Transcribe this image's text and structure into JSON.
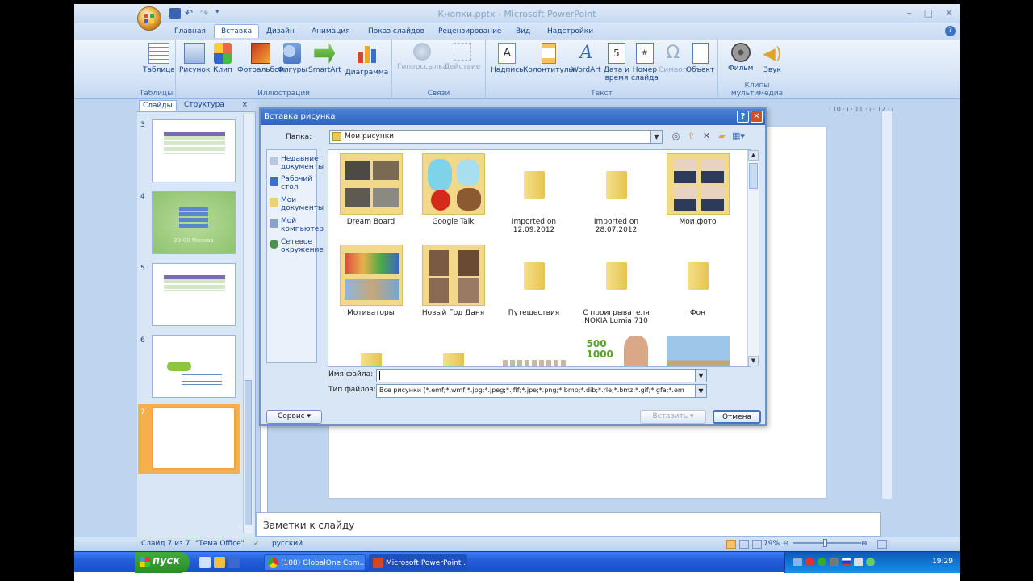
{
  "window": {
    "title": "Кнопки.pptx - Microsoft PowerPoint",
    "controls": [
      "–",
      "□",
      "✕"
    ]
  },
  "ribbon": {
    "tabs": [
      "Главная",
      "Вставка",
      "Дизайн",
      "Анимация",
      "Показ слайдов",
      "Рецензирование",
      "Вид",
      "Надстройки"
    ],
    "active_tab": "Вставка",
    "groups": {
      "tables": "Таблицы",
      "illustrations": "Иллюстрации",
      "links": "Связи",
      "text": "Текст",
      "media": "Клипы мультимедиа"
    },
    "buttons": {
      "table": "Таблица",
      "picture": "Рисунок",
      "clip": "Клип",
      "album": "Фотоальбом",
      "shapes": "Фигуры",
      "smartart": "SmartArt",
      "chart": "Диаграмма",
      "hyperlink": "Гиперссылка",
      "action": "Действие",
      "textbox": "Надпись",
      "header": "Колонтитулы",
      "wordart": "WordArt",
      "datetime_1": "Дата и",
      "datetime_2": "время",
      "slidenum_1": "Номер",
      "slidenum_2": "слайда",
      "symbol": "Символ",
      "object": "Объект",
      "movie": "Фильм",
      "sound": "Звук"
    }
  },
  "slides_panel": {
    "tabs": [
      "Слайды",
      "Структура"
    ],
    "slides": [
      {
        "num": "3"
      },
      {
        "num": "4",
        "caption": "20-00 Москва"
      },
      {
        "num": "5"
      },
      {
        "num": "6"
      },
      {
        "num": "7"
      }
    ]
  },
  "ruler_top": "· 10 · ı · 11 · ı · 12 · ı",
  "notes_placeholder": "Заметки к слайду",
  "status": {
    "slide": "Слайд 7 из 7",
    "theme": "\"Тема Office\"",
    "language": "русский",
    "zoom": "79%"
  },
  "dialog": {
    "title": "Вставка рисунка",
    "folder_label": "Папка:",
    "folder_value": "Мои рисунки",
    "places": [
      {
        "label": "Недавние документы"
      },
      {
        "label": "Рабочий стол"
      },
      {
        "label": "Мои документы"
      },
      {
        "label": "Мой компьютер"
      },
      {
        "label": "Сетевое окружение"
      }
    ],
    "files": [
      {
        "name": "Dream Board"
      },
      {
        "name": "Google Talk"
      },
      {
        "name": "Imported on 12.09.2012"
      },
      {
        "name": "Imported on 28.07.2012"
      },
      {
        "name": "Мои фото"
      },
      {
        "name": "Мотиваторы"
      },
      {
        "name": "Новый Год Даня"
      },
      {
        "name": "Путешествия"
      },
      {
        "name": "С проигрывателя NOKIA Lumia 710"
      },
      {
        "name": "Фон"
      }
    ],
    "filename_label": "Имя файла:",
    "filename_value": "",
    "filetype_label": "Тип файлов:",
    "filetype_value": "Все рисунки (*.emf;*.wmf;*.jpg;*.jpeg;*.jfif;*.jpe;*.png;*.bmp;*.dib;*.rle;*.bmz;*.gif;*.gfa;*.em",
    "service_button": "Сервис",
    "insert_button": "Вставить",
    "cancel_button": "Отмена",
    "partial_thumb_text": "500\n1000"
  },
  "taskbar": {
    "start": "пуск",
    "tasks": [
      {
        "label": "(108) GlobalOne Com..."
      },
      {
        "label": "Microsoft PowerPoint ..."
      }
    ],
    "clock": "19:29"
  }
}
